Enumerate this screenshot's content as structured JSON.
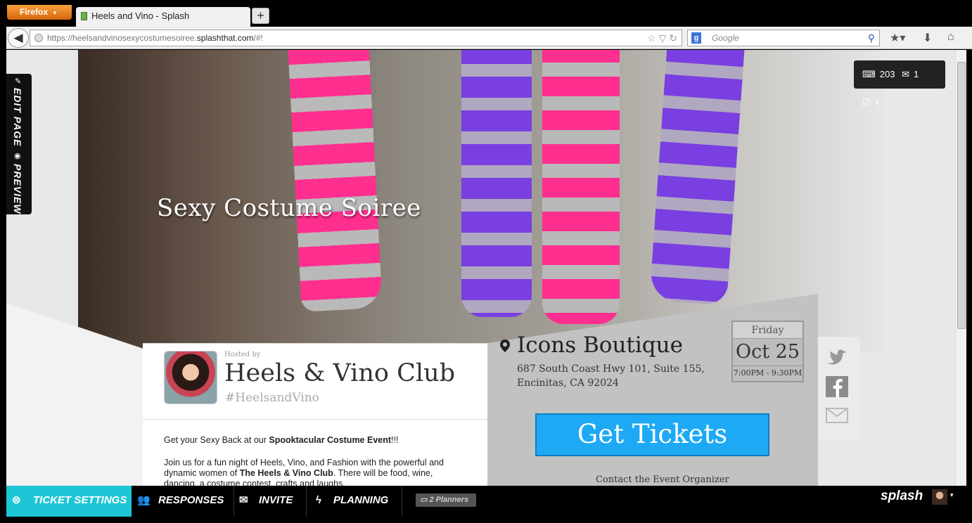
{
  "browser": {
    "menu_button": "Firefox",
    "tab_title": "Heels and Vino - Splash",
    "new_tab": "+",
    "url_prefix": "https://heelsandvinosexycostumesoiree.",
    "url_host": "splashthat.com",
    "url_suffix": "/#!",
    "search_placeholder": "Google",
    "search_engine_letter": "g"
  },
  "page": {
    "hero_title": "Sexy Costume Soiree",
    "stats": {
      "views": "203",
      "messages": "1",
      "plus": "+"
    },
    "edit_label": "EDIT PAGE",
    "preview_label": "PREVIEW",
    "host": {
      "hosted_by": "Hosted by",
      "name": "Heels & Vino Club",
      "hashtag": "#HeelsandVino"
    },
    "description": {
      "p1_pre": "Get your Sexy Back at our ",
      "p1_bold": "Spooktacular Costume Event",
      "p1_post": "!!!",
      "p2_pre": "Join us for a fun night of Heels, Vino, and Fashion with the powerful and dynamic women of ",
      "p2_bold": "The Heels & Vino Club",
      "p2_post": ". There will be food, wine, dancing, a costume contest, crafts and laughs."
    },
    "venue": {
      "name": "Icons Boutique",
      "address_line1": "687 South Coast Hwy 101, Suite 155,",
      "address_line2": "Encinitas, CA 92024"
    },
    "date": {
      "day": "Friday",
      "date": "Oct 25",
      "time": "7:00PM - 9:30PM"
    },
    "tickets_button": "Get Tickets",
    "contact_link": "Contact the Event Organizer"
  },
  "bottombar": {
    "ticket_settings": "TICKET SETTINGS",
    "responses": "RESPONSES",
    "invite": "INVITE",
    "planning": "PLANNING",
    "planners": "2 Planners",
    "brand": "splash"
  },
  "colors": {
    "accent": "#1cc6d6",
    "ticket_button": "#1ea9f4",
    "pink_sock": "#ff2f8f",
    "purple_sock": "#7a3fe0"
  }
}
